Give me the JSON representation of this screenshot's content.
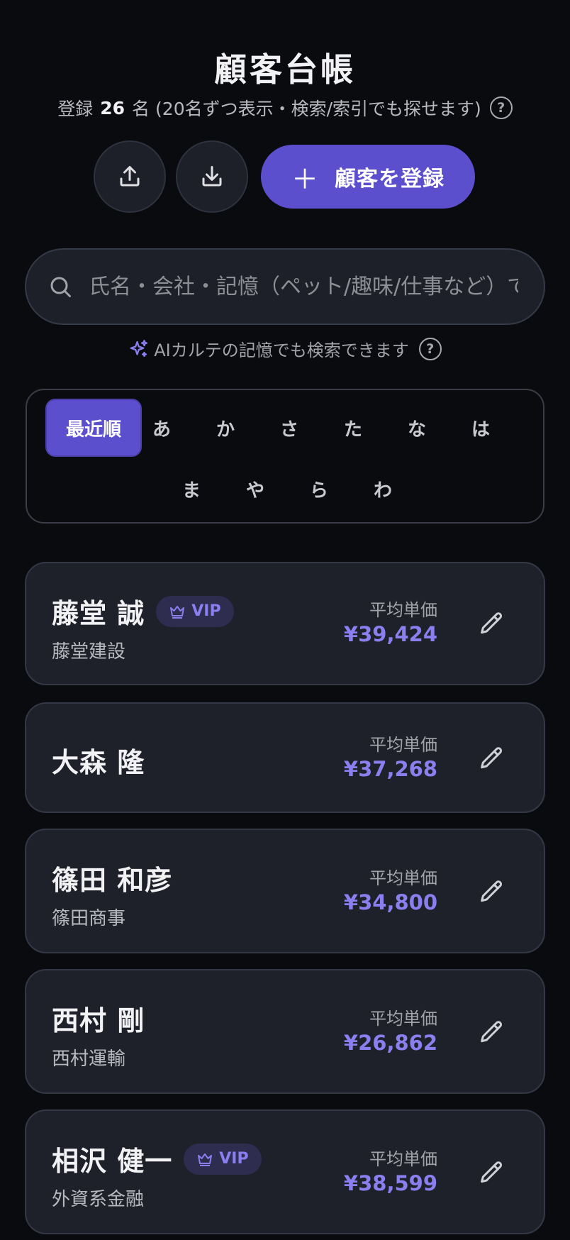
{
  "header": {
    "title": "顧客台帳",
    "count_prefix": "登録",
    "count": "26",
    "count_suffix": "名",
    "note": "(20名ずつ表示・検索/索引でも探せます)"
  },
  "actions": {
    "register_label": "顧客を登録",
    "upload_icon": "upload-icon",
    "download_icon": "download-icon"
  },
  "search": {
    "placeholder": "氏名・会社・記憶（ペット/趣味/仕事など）で検索"
  },
  "ai_hint": "AIカルテの記憶でも検索できます",
  "index_tabs": [
    "最近順",
    "あ",
    "か",
    "さ",
    "た",
    "な",
    "は",
    "ま",
    "や",
    "ら",
    "わ"
  ],
  "price_label": "平均単価",
  "customers": [
    {
      "name": "藤堂 誠",
      "vip": "VIP",
      "company": "藤堂建設",
      "price": "¥39,424"
    },
    {
      "name": "大森 隆",
      "vip": "",
      "company": "",
      "price": "¥37,268"
    },
    {
      "name": "篠田 和彦",
      "vip": "",
      "company": "篠田商事",
      "price": "¥34,800"
    },
    {
      "name": "西村 剛",
      "vip": "",
      "company": "西村運輸",
      "price": "¥26,862"
    },
    {
      "name": "相沢 健一",
      "vip": "VIP",
      "company": "外資系金融",
      "price": "¥38,599"
    }
  ],
  "colors": {
    "background": "#0a0b0f",
    "card": "#1e212a",
    "accent": "#5b4fce",
    "price": "#8b7ff0"
  }
}
